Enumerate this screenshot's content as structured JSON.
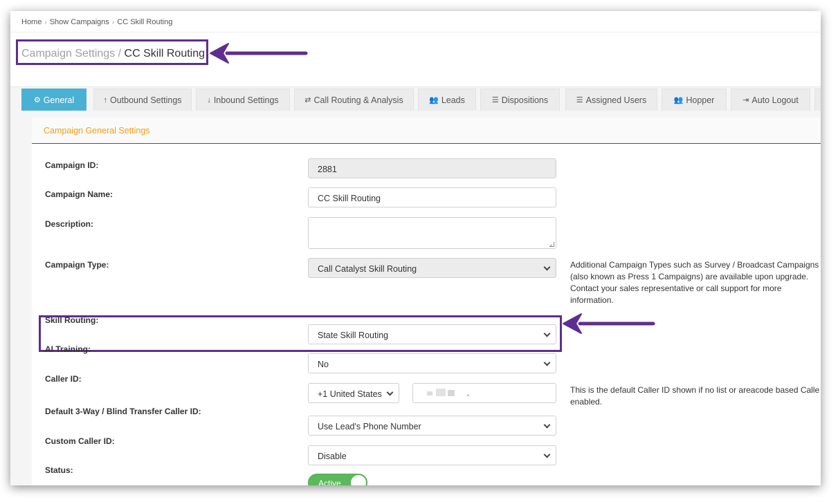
{
  "breadcrumb": {
    "home": "Home",
    "campaigns": "Show Campaigns",
    "current": "CC Skill Routing"
  },
  "page_title": {
    "section": "Campaign Settings / ",
    "name": "CC Skill Routing"
  },
  "tabs": [
    {
      "icon": "⚙",
      "label": "General"
    },
    {
      "icon": "↑",
      "label": "Outbound Settings"
    },
    {
      "icon": "↓",
      "label": "Inbound Settings"
    },
    {
      "icon": "⇄",
      "label": "Call Routing & Analysis"
    },
    {
      "icon": "👥",
      "label": "Leads"
    },
    {
      "icon": "☰",
      "label": "Dispositions"
    },
    {
      "icon": "☰",
      "label": "Assigned Users"
    },
    {
      "icon": "👥",
      "label": "Hopper"
    },
    {
      "icon": "⇥",
      "label": "Auto Logout"
    }
  ],
  "panel_title": "Campaign General Settings",
  "fields": {
    "campaign_id": {
      "label": "Campaign ID:",
      "value": "2881"
    },
    "campaign_name": {
      "label": "Campaign Name:",
      "value": "CC Skill Routing"
    },
    "description": {
      "label": "Description:",
      "value": ""
    },
    "campaign_type": {
      "label": "Campaign Type:",
      "value": "Call Catalyst Skill Routing",
      "help": "Additional Campaign Types such as Survey / Broadcast Campaigns (also known as Press 1 Campaigns) are available upon upgrade. Contact your sales representative or call support for more information."
    },
    "skill_routing": {
      "label": "Skill Routing:",
      "value": "State Skill Routing"
    },
    "ai_training": {
      "label": "AI Training:",
      "value": "No"
    },
    "caller_id": {
      "label": "Caller ID:",
      "country": "+1 United States",
      "help": "This is the default Caller ID shown if no list or areacode based Calle enabled."
    },
    "transfer_caller_id": {
      "label": "Default 3-Way / Blind Transfer Caller ID:",
      "value": "Use Lead's Phone Number"
    },
    "custom_caller_id": {
      "label": "Custom Caller ID:",
      "value": "Disable"
    },
    "status": {
      "label": "Status:",
      "value": "Active"
    }
  },
  "colors": {
    "annotation": "#5e2d91",
    "active_tab": "#4ab1d4",
    "panel_title": "#f39c12",
    "toggle_on": "#5cb85c"
  }
}
